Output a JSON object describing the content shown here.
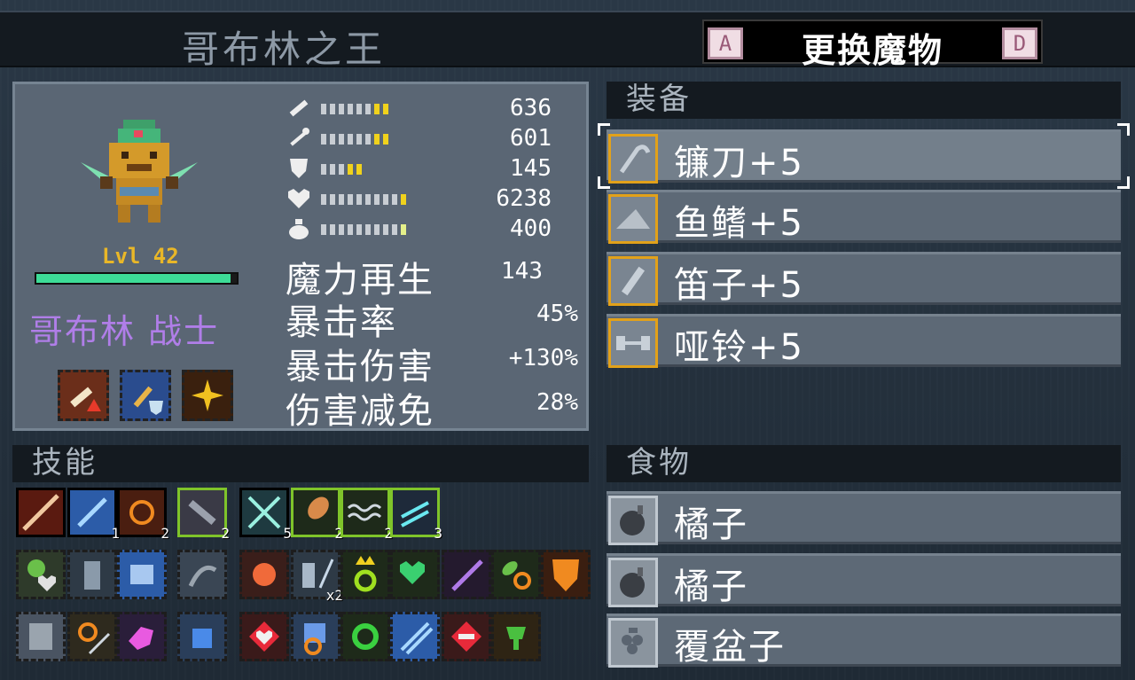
{
  "header": {
    "monster_name": "哥布林之王",
    "change_label": "更换魔物",
    "key_left": "A",
    "key_right": "D"
  },
  "monster": {
    "level": "Lvl 42",
    "species": "哥布林 战士",
    "hp_fraction": 0.97
  },
  "stats": {
    "attack": "636",
    "magic": "601",
    "defense": "145",
    "health": "6238",
    "mana": "400",
    "mana_regen_label": "魔力再生",
    "mana_regen": "143",
    "crit_rate_label": "暴击率",
    "crit_rate": "45%",
    "crit_damage_label": "暴击伤害",
    "crit_damage": "+130%",
    "damage_reduction_label": "伤害减免",
    "damage_reduction": "28%"
  },
  "sections": {
    "skills": "技能",
    "equipment": "装备",
    "food": "食物"
  },
  "equipment": [
    {
      "label": "镰刀+5",
      "icon": "scythe-icon"
    },
    {
      "label": "鱼鳍+5",
      "icon": "fin-icon"
    },
    {
      "label": "笛子+5",
      "icon": "flute-icon"
    },
    {
      "label": "哑铃+5",
      "icon": "dumbbell-icon"
    }
  ],
  "food": [
    {
      "label": "橘子",
      "icon": "bomb-fruit-icon"
    },
    {
      "label": "橘子",
      "icon": "bomb-fruit-icon"
    },
    {
      "label": "覆盆子",
      "icon": "raspberry-icon"
    }
  ],
  "skill_counts": {
    "r1": [
      "",
      "1",
      "2",
      "2",
      "5",
      "2",
      "2",
      "3"
    ],
    "r2_x2": "x2"
  },
  "colors": {
    "accent_gold": "#e2a11a",
    "species_purple": "#b07ee8",
    "hp_green": "#3ddc97"
  }
}
